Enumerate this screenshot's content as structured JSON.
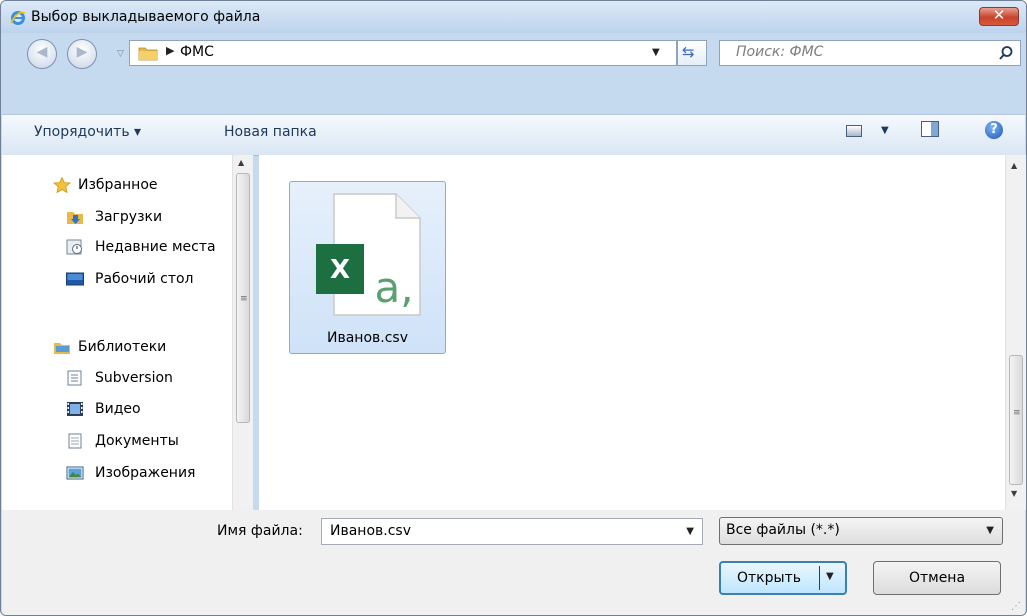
{
  "window": {
    "title": "Выбор выкладываемого файла",
    "close_glyph": "✕"
  },
  "navigation": {
    "back_glyph": "◀",
    "forward_glyph": "▶",
    "history_dropdown_glyph": "▽",
    "address_path": "ФМС",
    "address_separator": "▶",
    "address_dropdown_glyph": "▼",
    "refresh_glyph": "⇆",
    "search_placeholder": "Поиск: ФМС"
  },
  "commands": {
    "organize": "Упорядочить ▾",
    "new_folder": "Новая папка",
    "views_dropdown_glyph": "▼",
    "help_glyph": "?"
  },
  "sidebar": {
    "favorites": {
      "header": "Избранное",
      "items": [
        {
          "label": "Загрузки",
          "icon": "downloads-folder-icon"
        },
        {
          "label": "Недавние места",
          "icon": "recent-places-icon"
        },
        {
          "label": "Рабочий стол",
          "icon": "desktop-icon"
        }
      ]
    },
    "libraries": {
      "header": "Библиотеки",
      "items": [
        {
          "label": "Subversion",
          "icon": "subversion-icon"
        },
        {
          "label": "Видео",
          "icon": "video-icon"
        },
        {
          "label": "Документы",
          "icon": "documents-icon"
        },
        {
          "label": "Изображения",
          "icon": "pictures-icon"
        }
      ]
    },
    "scroll_up_glyph": "▲",
    "scroll_grip_glyph": "≡"
  },
  "files": [
    {
      "name": "Иванов.csv",
      "icon": "excel-csv-file-icon",
      "selected": true
    }
  ],
  "file_pane": {
    "scroll_up_glyph": "▲",
    "scroll_down_glyph": "▼",
    "scroll_grip_glyph": "≡"
  },
  "footer": {
    "filename_label": "Имя файла:",
    "filename_value": "Иванов.csv",
    "filename_dropdown_glyph": "▼",
    "filter_value": "Все файлы (*.*)",
    "filter_dropdown_glyph": "▼",
    "open_label": "Открыть",
    "open_split_glyph": "▼",
    "cancel_label": "Отмена",
    "resize_grip_glyph": "⋰"
  },
  "colors": {
    "window_frame": "#c5d9ef",
    "selection_fill": "#cfe2f8",
    "selection_border": "#84acdd",
    "excel_green": "#1d6f42",
    "close_red": "#c8432c",
    "link_blue": "#1e395b"
  }
}
